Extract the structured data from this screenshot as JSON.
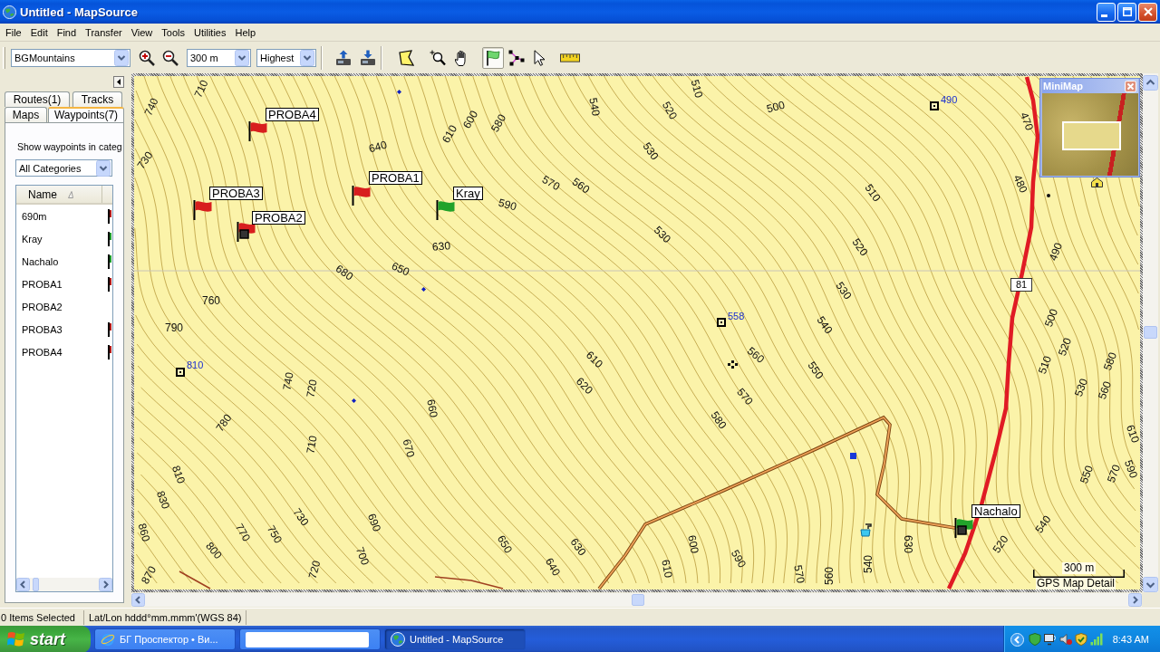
{
  "window": {
    "title": "Untitled - MapSource"
  },
  "menu": [
    "File",
    "Edit",
    "Find",
    "Transfer",
    "View",
    "Tools",
    "Utilities",
    "Help"
  ],
  "toolbar": {
    "map_product": "BGMountains",
    "zoom_buttons": [
      {
        "kind": "zoom_in"
      },
      {
        "kind": "zoom_out"
      }
    ],
    "scale": "300 m",
    "detail": "Highest",
    "device_buttons": [
      {
        "kind": "receive"
      },
      {
        "kind": "send"
      }
    ],
    "tools": [
      {
        "kind": "area",
        "selected": false
      },
      {
        "kind": "zoom",
        "selected": false
      },
      {
        "kind": "pan",
        "selected": false
      },
      {
        "kind": "waypoint",
        "selected": true
      },
      {
        "kind": "route",
        "selected": false
      },
      {
        "kind": "select",
        "selected": false
      },
      {
        "kind": "measure",
        "selected": false
      }
    ]
  },
  "sidebar": {
    "tab_rows": [
      {
        "tabs": [
          {
            "label": "Routes(1)",
            "selected": false
          },
          {
            "label": "Tracks",
            "selected": false
          }
        ]
      },
      {
        "tabs": [
          {
            "label": "Maps",
            "selected": false
          },
          {
            "label": "Waypoints(7)",
            "selected": true
          }
        ]
      }
    ],
    "category_label": "Show waypoints in categ",
    "category": "All Categories",
    "list_header": "Name",
    "waypoints": [
      {
        "name": "690m",
        "color": "#b01818"
      },
      {
        "name": "Kray",
        "color": "#1e9a2c"
      },
      {
        "name": "Nachalo",
        "color": "#1e9a2c"
      },
      {
        "name": "PROBA1",
        "color": "#b01818"
      },
      {
        "name": "PROBA2"
      },
      {
        "name": "PROBA3",
        "color": "#b01818"
      },
      {
        "name": "PROBA4",
        "color": "#b01818"
      }
    ]
  },
  "map": {
    "contour_labels": [
      "710",
      "740",
      "730",
      "640",
      "610",
      "600",
      "580",
      "590",
      "630",
      "650",
      "680",
      "760",
      "790",
      "540",
      "520",
      "510",
      "500",
      "530",
      "570",
      "560",
      "530",
      "510",
      "520",
      "530",
      "540",
      "550",
      "560",
      "570",
      "580",
      "610",
      "620",
      "660",
      "670",
      "740",
      "720",
      "710",
      "780",
      "810",
      "830",
      "860",
      "870",
      "800",
      "770",
      "750",
      "730",
      "690",
      "700",
      "720",
      "650",
      "640",
      "630",
      "610",
      "600",
      "590",
      "570",
      "560",
      "540",
      "630",
      "520",
      "540",
      "470",
      "480",
      "490",
      "500",
      "520",
      "510",
      "530",
      "580",
      "560",
      "550",
      "570",
      "610",
      "590"
    ],
    "spot_heights": [
      "490",
      "558",
      "810"
    ],
    "road_number": "81",
    "waypoints": [
      {
        "name": "PROBA4",
        "kind": "flag",
        "color": "#d81e1e"
      },
      {
        "name": "PROBA1",
        "kind": "flag",
        "color": "#d81e1e"
      },
      {
        "name": "PROBA3",
        "kind": "flag",
        "color": "#d81e1e"
      },
      {
        "name": "Kray",
        "kind": "flag",
        "color": "#22a22a"
      },
      {
        "name": "PROBA2",
        "kind": "flag_square",
        "color": "#d81e1e"
      },
      {
        "name": "Nachalo",
        "kind": "flag_square",
        "color": "#22a22a"
      }
    ],
    "scale": "300 m",
    "detail": "GPS Map Detail",
    "minimap": {
      "title": "MiniMap"
    }
  },
  "status_bar": [
    "0 Items Selected",
    "Lat/Lon hddd°mm.mmm'(WGS 84)"
  ],
  "taskbar": {
    "start": "start",
    "tasks": [
      {
        "kind": "browser",
        "label": "БГ Проспектор • Ви...",
        "selected": false
      },
      {
        "kind": "blank",
        "selected": false
      },
      {
        "kind": "app",
        "label": "Untitled - MapSource",
        "selected": true
      }
    ],
    "clock": "8:43 AM"
  }
}
